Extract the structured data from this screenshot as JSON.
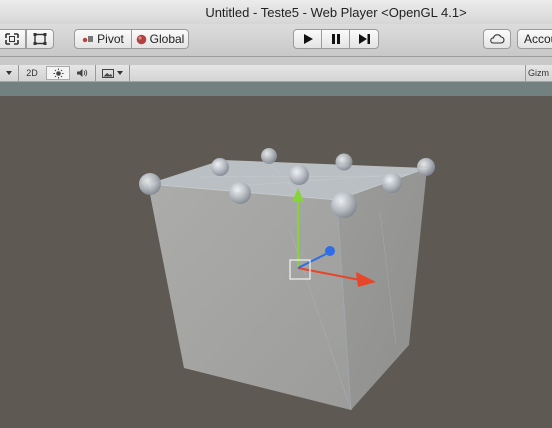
{
  "window": {
    "title": "Untitled - Teste5 - Web Player <OpenGL 4.1>"
  },
  "toolbar": {
    "pivot_label": "Pivot",
    "global_label": "Global",
    "account_label": "Accou"
  },
  "scene_toolbar": {
    "mode_2d_label": "2D",
    "gizmos_label": "Gizm"
  },
  "icons": {
    "move_tool": "move-arrows-icon",
    "rect_tool": "rect-tool-icon",
    "play": "play-icon",
    "pause": "pause-icon",
    "step": "step-icon",
    "cloud": "cloud-icon",
    "light": "sun-icon",
    "audio": "speaker-icon",
    "effects": "image-icon"
  },
  "colors": {
    "background": "#5e5953",
    "cube_front": "#a3a3a1",
    "cube_right": "#969694",
    "cube_top": "#b9bfc3",
    "y_axis": "#86d43a",
    "x_axis": "#e8462a",
    "z_axis": "#2f6de6"
  }
}
